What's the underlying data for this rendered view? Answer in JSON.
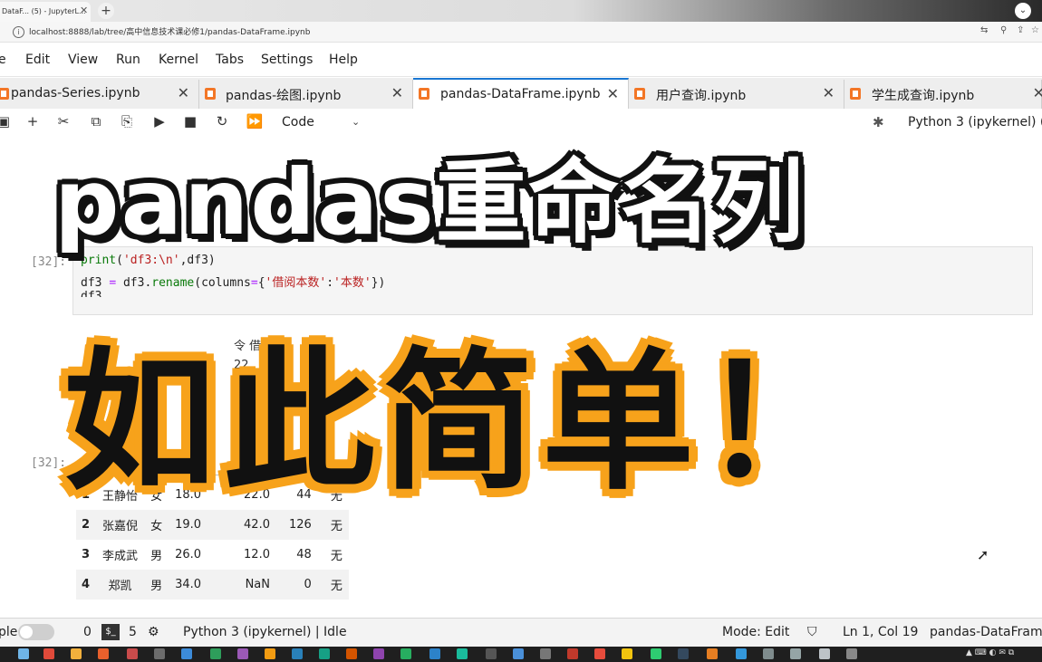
{
  "browser": {
    "tab_title": "DataF... (5) - JupyterL...",
    "tab_close": "✕",
    "new_tab": "+",
    "address": "localhost:8888/lab/tree/高中信息技术课必修1/pandas-DataFrame.ipynb"
  },
  "menubar": {
    "items": [
      "e",
      "Edit",
      "View",
      "Run",
      "Kernel",
      "Tabs",
      "Settings",
      "Help"
    ]
  },
  "doc_tabs": [
    {
      "label": "pandas-Series.ipynb",
      "active": false
    },
    {
      "label": "pandas-绘图.ipynb",
      "active": false
    },
    {
      "label": "pandas-DataFrame.ipynb",
      "active": true
    },
    {
      "label": "用户查询.ipynb",
      "active": false
    },
    {
      "label": "学生成查询.ipynb",
      "active": false
    }
  ],
  "toolbar": {
    "cell_type": "Code",
    "kernel": "Python 3 (ipykernel) ("
  },
  "cell": {
    "prompt": "[32]:",
    "line1_fn": "print",
    "line1_rest": "(",
    "line1_str": "'df3:\\n'",
    "line1_tail": ",df3)",
    "line2_a": "df3 ",
    "line2_op": "=",
    "line2_b": " df3.",
    "line2_fn": "rename",
    "line2_c": "(columns",
    "line2_op2": "=",
    "line2_d": "{",
    "line2_str1": "'借阅本数'",
    "line2_e": ":",
    "line2_str2": "'本数'",
    "line2_f": "})",
    "line3": "df3"
  },
  "output_frag": {
    "line1": "令  借阅      长",
    "line2": "22",
    "line3": "42",
    "line4": "12",
    "line5": "Na",
    "line6": "3",
    "left6": "6"
  },
  "out_prompt": "[32]:",
  "table_header_frag": "龄",
  "table_rows": [
    {
      "idx": "1",
      "name": "王静怡",
      "sex": "女",
      "age": "18.0",
      "borrow": "22.0",
      "pages": "44",
      "note": "无"
    },
    {
      "idx": "2",
      "name": "张嘉倪",
      "sex": "女",
      "age": "19.0",
      "borrow": "42.0",
      "pages": "126",
      "note": "无"
    },
    {
      "idx": "3",
      "name": "李成武",
      "sex": "男",
      "age": "26.0",
      "borrow": "12.0",
      "pages": "48",
      "note": "无"
    },
    {
      "idx": "4",
      "name": "郑凯",
      "sex": "男",
      "age": "34.0",
      "borrow": "NaN",
      "pages": "0",
      "note": "无"
    }
  ],
  "banner": {
    "title": "pandas重命名列",
    "subtitle": "如此简单！"
  },
  "statusbar": {
    "simple_label": "ple",
    "count_a": "0",
    "terminal_icon": "$_",
    "count_b": "5",
    "kernel_status": "Python 3 (ipykernel) | Idle",
    "mode": "Mode: Edit",
    "cursor_pos": "Ln 1, Col 19",
    "file": "pandas-DataFrame"
  }
}
